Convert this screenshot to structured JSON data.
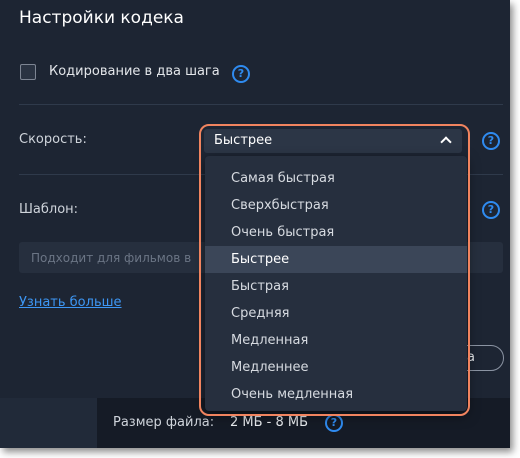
{
  "dialog": {
    "title": "Настройки кодека"
  },
  "two_pass": {
    "label": "Кодирование в два шага",
    "checked": false
  },
  "speed": {
    "label": "Скорость:",
    "selected": "Быстрее",
    "options": [
      "Самая быстрая",
      "Сверхбыстрая",
      "Очень быстрая",
      "Быстрее",
      "Быстрая",
      "Средняя",
      "Медленная",
      "Медленнее",
      "Очень медленная"
    ],
    "selected_index": 3
  },
  "template": {
    "label": "Шаблон:",
    "placeholder": "Подходит для фильмов в"
  },
  "learn_more": "Узнать больше",
  "buttons": {
    "ghost_label": "а"
  },
  "footer": {
    "file_size_label": "Размер файла:",
    "file_size_value": "2 МБ - 8 МБ"
  },
  "help_glyph": "?",
  "colors": {
    "background": "#1d2533",
    "accent": "#2f8bf0",
    "highlight": "#f1845f",
    "dropdown_bg": "#262f3e",
    "selected_bg": "#3b4658"
  }
}
